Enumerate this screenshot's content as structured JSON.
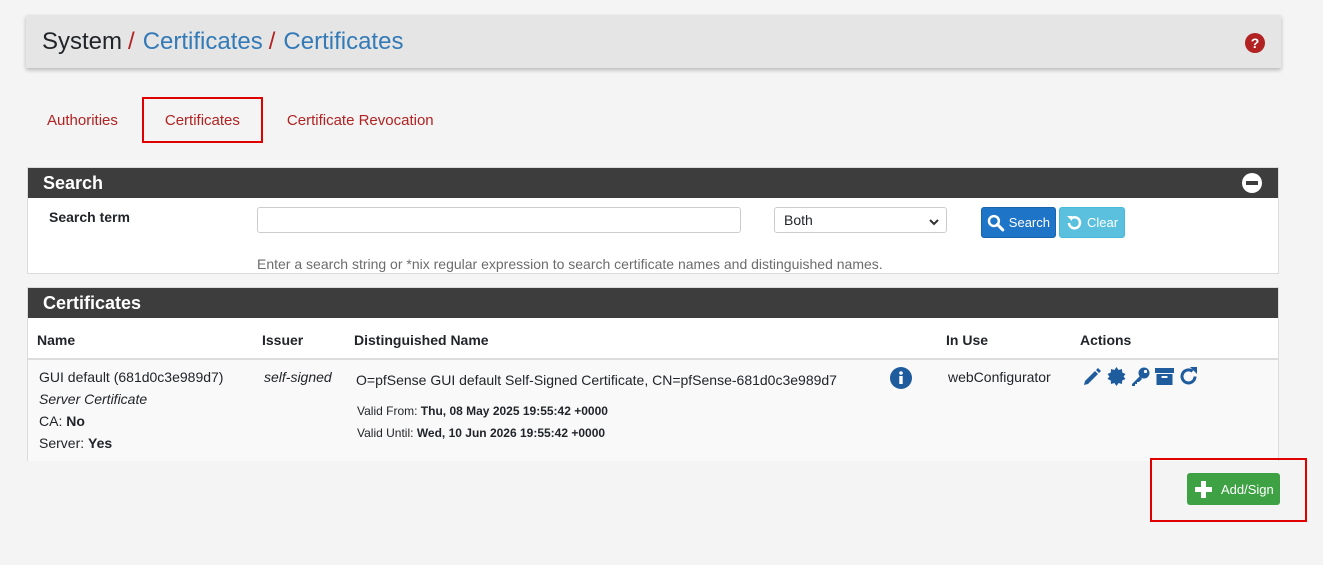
{
  "breadcrumb": {
    "system": "System",
    "sep1": "/",
    "certificates_parent": "Certificates",
    "sep2": "/",
    "certificates_current": "Certificates"
  },
  "tabs": [
    {
      "label": "Authorities"
    },
    {
      "label": "Certificates",
      "active": true
    },
    {
      "label": "Certificate Revocation"
    }
  ],
  "search": {
    "heading": "Search",
    "term_label": "Search term",
    "input_value": "",
    "select_value": "Both",
    "search_button": "Search",
    "clear_button": "Clear",
    "help_text": "Enter a search string or *nix regular expression to search certificate names and distinguished names."
  },
  "certificates": {
    "heading": "Certificates",
    "columns": [
      "Name",
      "Issuer",
      "Distinguished Name",
      "In Use",
      "Actions"
    ],
    "rows": [
      {
        "name": "GUI default (681d0c3e989d7)",
        "type": "Server Certificate",
        "ca_label": "CA: ",
        "ca_value": "No",
        "server_label": "Server: ",
        "server_value": "Yes",
        "issuer": "self-signed",
        "dn": "O=pfSense GUI default Self-Signed Certificate, CN=pfSense-681d0c3e989d7",
        "valid_from_label": "Valid From: ",
        "valid_from": "Thu, 08 May 2025 19:55:42 +0000",
        "valid_until_label": "Valid Until: ",
        "valid_until": "Wed, 10 Jun 2026 19:55:42 +0000",
        "in_use": "webConfigurator",
        "action_icons": [
          "pencil-icon",
          "badge-icon",
          "key-icon",
          "archive-icon",
          "refresh-icon"
        ]
      }
    ]
  },
  "add_button": "Add/Sign",
  "colors": {
    "link": "#337ab7",
    "tab_red": "#b22222",
    "panel_heading": "#3d3d3d",
    "success": "#3ea244",
    "primary": "#1e74c6",
    "info": "#5bc0de",
    "highlight": "#e00000"
  }
}
